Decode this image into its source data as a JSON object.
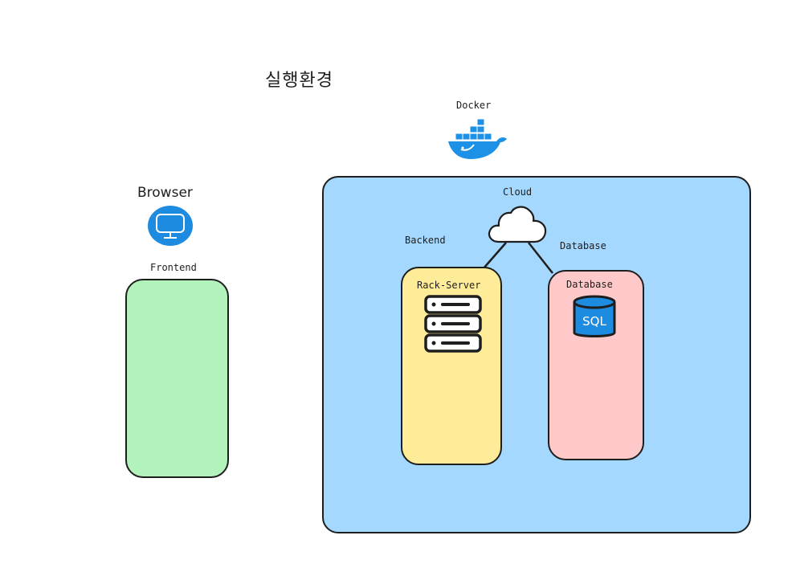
{
  "title": "실행환경",
  "docker": {
    "label": "Docker",
    "icon": "docker-whale-icon",
    "color": "#1d91e6"
  },
  "browser": {
    "label": "Browser",
    "icon": "monitor-icon",
    "color": "#1d8be0"
  },
  "frontend": {
    "label": "Frontend",
    "color": "#b2f2bb"
  },
  "cloud": {
    "label": "Cloud",
    "icon": "cloud-icon",
    "color": "#a5d8ff"
  },
  "backend": {
    "label": "Backend",
    "server_label": "Rack-Server",
    "icon": "server-rack-icon",
    "color": "#ffec99"
  },
  "database": {
    "label": "Database",
    "inner_label": "Database",
    "icon": "sql-database-icon",
    "icon_text": "SQL",
    "color": "#ffc9c9"
  }
}
